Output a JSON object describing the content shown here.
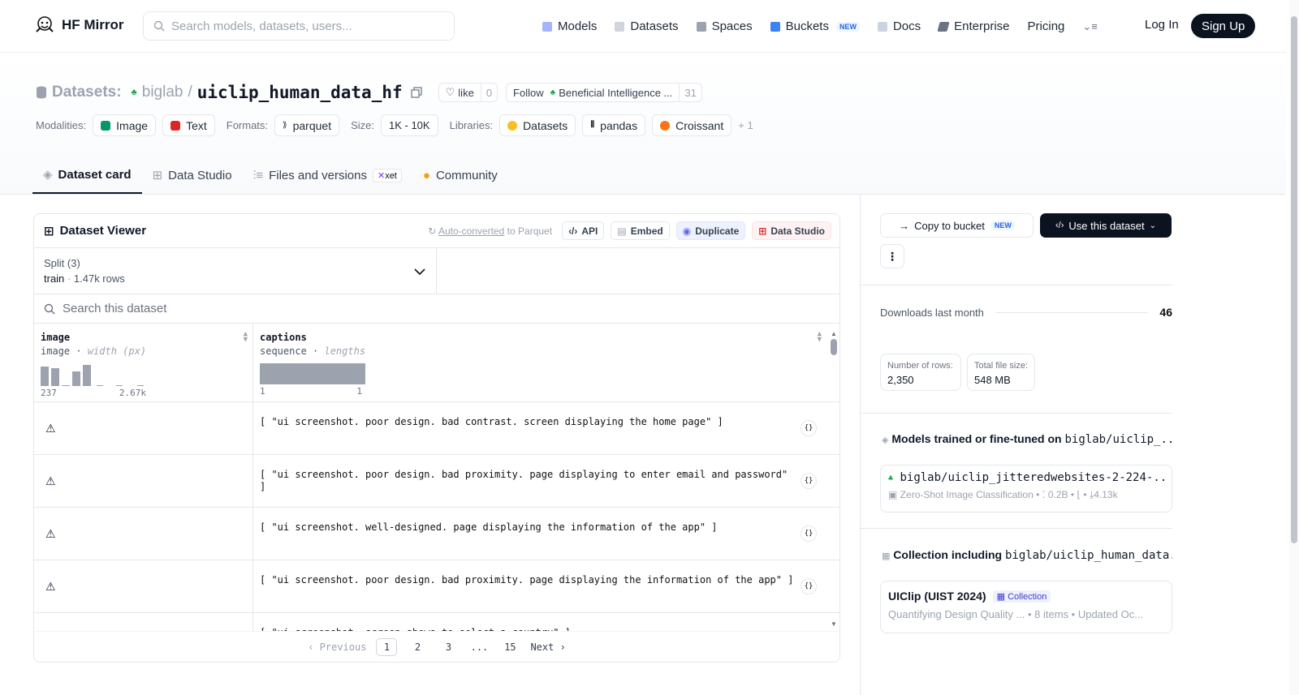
{
  "nav": {
    "logo": "HF Mirror",
    "search_placeholder": "Search models, datasets, users...",
    "links": [
      "Models",
      "Datasets",
      "Spaces",
      "Buckets",
      "Docs",
      "Enterprise",
      "Pricing"
    ],
    "buckets_badge": "NEW",
    "login": "Log In",
    "signup": "Sign Up"
  },
  "header": {
    "prefix": "Datasets:",
    "owner": "biglab",
    "sep": "/",
    "repo": "uiclip_human_data_hf",
    "like_label": "like",
    "like_count": "0",
    "follow_label": "Follow",
    "follow_org": "Beneficial Intelligence ...",
    "follow_count": "31"
  },
  "meta": {
    "modalities_label": "Modalities:",
    "modalities": [
      "Image",
      "Text"
    ],
    "formats_label": "Formats:",
    "format": "parquet",
    "size_label": "Size:",
    "size": "1K - 10K",
    "libraries_label": "Libraries:",
    "libraries": [
      "Datasets",
      "pandas",
      "Croissant"
    ],
    "more": "+ 1"
  },
  "tabs": [
    "Dataset card",
    "Data Studio",
    "Files and versions",
    "Community"
  ],
  "xet_badge": "xet",
  "viewer": {
    "title": "Dataset Viewer",
    "auto_converted_link": "Auto-converted",
    "auto_converted_rest": " to Parquet",
    "buttons": [
      "API",
      "Embed",
      "Duplicate",
      "Data Studio"
    ],
    "split_label": "Split (3)",
    "split_value": "train",
    "split_rows": "1.47k rows",
    "search_placeholder": "Search this dataset",
    "col1": {
      "name": "image",
      "type": "image",
      "stat": "width (px)",
      "min": "237",
      "max": "2.67k"
    },
    "col2": {
      "name": "captions",
      "type": "sequence",
      "stat": "lengths",
      "min": "1",
      "max": "1"
    },
    "rows": [
      "[ \"ui screenshot. poor design. bad contrast. screen displaying the home page\" ]",
      "[ \"ui screenshot. poor design. bad proximity. page displaying to enter email and password\" ]",
      "[ \"ui screenshot. well-designed. page displaying the information of the app\" ]",
      "[ \"ui screenshot. poor design. bad proximity. page displaying the information of the app\" ]",
      "[ \"ui screenshot. screen shows to select a country\" ]"
    ],
    "pager": {
      "prev": "Previous",
      "pages": [
        "1",
        "2",
        "3",
        "...",
        "15"
      ],
      "next": "Next",
      "current": "1"
    }
  },
  "sidebar": {
    "copy_bucket": "Copy to bucket",
    "copy_badge": "NEW",
    "use_dataset": "Use this dataset",
    "downloads_label": "Downloads last month",
    "downloads": "46",
    "rows_label": "Number of rows:",
    "rows": "2,350",
    "filesize_label": "Total file size:",
    "filesize": "548 MB",
    "models_heading": "Models trained or fine-tuned on",
    "models_repo": "biglab/uiclip_...",
    "model_name": "biglab/uiclip_jitteredwebsites-2-224-...",
    "model_task": "Zero-Shot Image Classification",
    "model_params": "0.2B",
    "model_downloads": "4.13k",
    "collection_heading": "Collection including",
    "collection_repo": "biglab/uiclip_human_data...",
    "collection_name": "UIClip (UIST 2024)",
    "collection_badge": "Collection",
    "collection_desc": "Quantifying Design Quality ...",
    "collection_items": "8 items",
    "collection_updated": "Updated Oc..."
  },
  "colors": {
    "accent_dark": "#0b1220",
    "new_badge": "#2563eb",
    "data_studio": "#dc2626"
  }
}
